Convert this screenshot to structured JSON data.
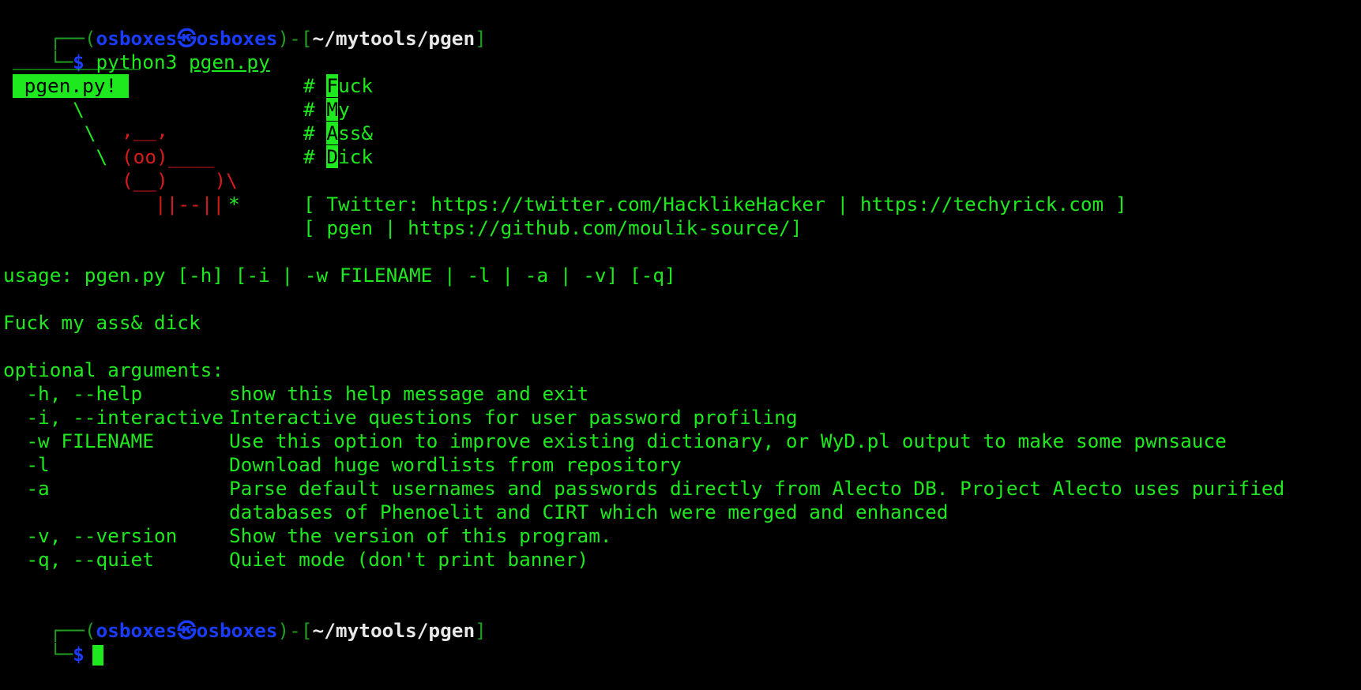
{
  "prompt": {
    "corner_top": "┌──",
    "corner_bottom": "└─",
    "open_paren": "(",
    "user_host": "osboxes㉿osboxes",
    "close_paren": ")-[",
    "path": "~/mytools/pgen",
    "close_bracket": "]",
    "dollar": "$"
  },
  "command": {
    "program": "python3",
    "argument": "pgen.py"
  },
  "banner": {
    "dashes": "___________",
    "title": " pgen.py! ",
    "ascii_lines": [
      "      \\",
      "       \\",
      "        \\"
    ],
    "cow": {
      "horns": ",__,",
      "face": "(oo)____",
      "body": "(__)    )\\",
      "legs": "||--||",
      "star": "*"
    },
    "hash_lines": [
      {
        "hash": "#",
        "first": "F",
        "rest": "uck"
      },
      {
        "hash": "#",
        "first": "M",
        "rest": "y"
      },
      {
        "hash": "#",
        "first": "A",
        "rest": "ss&"
      },
      {
        "hash": "#",
        "first": "D",
        "rest": "ick"
      }
    ],
    "links_line_1": "[ Twitter: https://twitter.com/HacklikeHacker | https://techyrick.com ]",
    "links_line_2": "[ pgen | https://github.com/moulik-source/]"
  },
  "usage": "usage: pgen.py [-h] [-i | -w FILENAME | -l | -a | -v] [-q]",
  "description": "Fuck my ass& dick",
  "optional_header": "optional arguments:",
  "options": [
    {
      "flag": "  -h, --help",
      "desc": "show this help message and exit"
    },
    {
      "flag": "  -i, --interactive",
      "desc": "Interactive questions for user password profiling"
    },
    {
      "flag": "  -w FILENAME",
      "desc": "Use this option to improve existing dictionary, or WyD.pl output to make some pwnsauce"
    },
    {
      "flag": "  -l",
      "desc": "Download huge wordlists from repository"
    },
    {
      "flag": "  -a",
      "desc": "Parse default usernames and passwords directly from Alecto DB. Project Alecto uses purified"
    },
    {
      "flag": "",
      "desc": "databases of Phenoelit and CIRT which were merged and enhanced"
    },
    {
      "flag": "  -v, --version",
      "desc": "Show the version of this program."
    },
    {
      "flag": "  -q, --quiet",
      "desc": "Quiet mode (don't print banner)"
    }
  ],
  "colors": {
    "background": "#000000",
    "text_green": "#1ee81e",
    "user_blue": "#1a3cff",
    "cow_red": "#d71a1a"
  }
}
